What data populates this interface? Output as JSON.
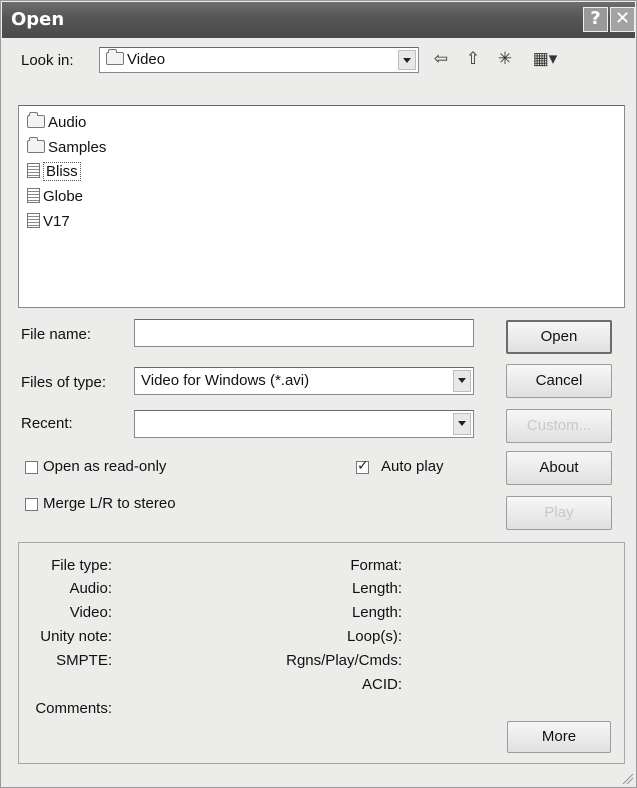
{
  "title": "Open",
  "title_buttons": {
    "help": "?",
    "close": "✕"
  },
  "look_in": {
    "label": "Look in:",
    "value": "Video"
  },
  "toolbar": {
    "back_icon": "⇦",
    "up_icon": "⇧",
    "new_folder_icon": "✳",
    "view_icon": "▦"
  },
  "files": [
    {
      "name": "Audio",
      "icon": "folder-icon"
    },
    {
      "name": "Samples",
      "icon": "folder-icon"
    },
    {
      "name": "Bliss",
      "icon": "video-file-icon",
      "selected": true
    },
    {
      "name": "Globe",
      "icon": "video-file-icon"
    },
    {
      "name": "V17",
      "icon": "video-file-icon"
    }
  ],
  "form": {
    "file_name_label": "File name:",
    "file_name_value": "",
    "files_of_type_label": "Files of type:",
    "files_of_type_value": "Video for Windows (*.avi)",
    "recent_label": "Recent:",
    "recent_value": ""
  },
  "options": {
    "read_only_label": "Open as read-only",
    "read_only_checked": false,
    "auto_play_label": "Auto play",
    "auto_play_checked": true,
    "merge_label": "Merge L/R to stereo",
    "merge_checked": false
  },
  "buttons": {
    "open": "Open",
    "cancel": "Cancel",
    "custom": "Custom...",
    "about": "About",
    "play": "Play",
    "more": "More"
  },
  "info": {
    "file_type": "File type:",
    "audio": "Audio:",
    "video": "Video:",
    "unity_note": "Unity note:",
    "smpte": "SMPTE:",
    "comments": "Comments:",
    "format": "Format:",
    "length_1": "Length:",
    "length_2": "Length:",
    "loops": "Loop(s):",
    "rgns": "Rgns/Play/Cmds:",
    "acid": "ACID:"
  }
}
